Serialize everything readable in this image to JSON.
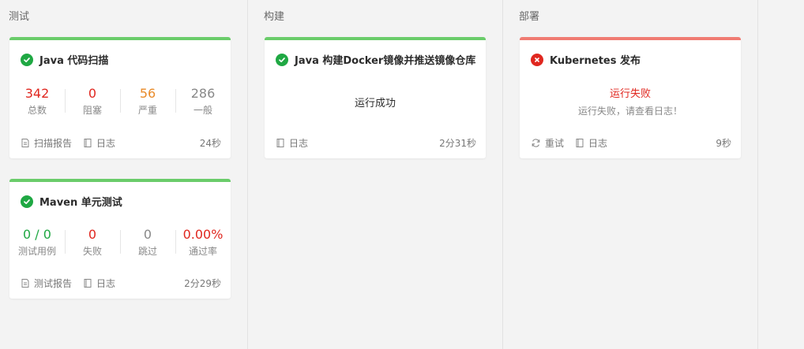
{
  "colors": {
    "success_green": "#1fa843",
    "fail_red": "#e0271f",
    "warning_orange": "#e98b2a",
    "neutral_gray": "#888888"
  },
  "stages": [
    {
      "name": "测试",
      "jobs": [
        {
          "title": "Java 代码扫描",
          "status": "success",
          "stats": [
            {
              "value": "342",
              "label": "总数",
              "color": "#e0271f"
            },
            {
              "value": "0",
              "label": "阻塞",
              "color": "#e0271f"
            },
            {
              "value": "56",
              "label": "严重",
              "color": "#e98b2a"
            },
            {
              "value": "286",
              "label": "一般",
              "color": "#888888"
            }
          ],
          "report_link": "扫描报告",
          "log_link": "日志",
          "duration": "24秒"
        },
        {
          "title": "Maven 单元测试",
          "status": "success",
          "stats": [
            {
              "value": "0 / 0",
              "label": "测试用例",
              "color": "#1fa843"
            },
            {
              "value": "0",
              "label": "失败",
              "color": "#e0271f"
            },
            {
              "value": "0",
              "label": "跳过",
              "color": "#888888"
            },
            {
              "value": "0.00%",
              "label": "通过率",
              "color": "#e0271f"
            }
          ],
          "report_link": "测试报告",
          "log_link": "日志",
          "duration": "2分29秒"
        }
      ]
    },
    {
      "name": "构建",
      "jobs": [
        {
          "title": "Java 构建Docker镜像并推送镜像仓库",
          "status": "success",
          "message": "运行成功",
          "log_link": "日志",
          "duration": "2分31秒"
        }
      ]
    },
    {
      "name": "部署",
      "jobs": [
        {
          "title": "Kubernetes 发布",
          "status": "failed",
          "message": "运行失败",
          "detail": "运行失败，请查看日志！",
          "retry_link": "重试",
          "log_link": "日志",
          "duration": "9秒"
        }
      ]
    }
  ]
}
